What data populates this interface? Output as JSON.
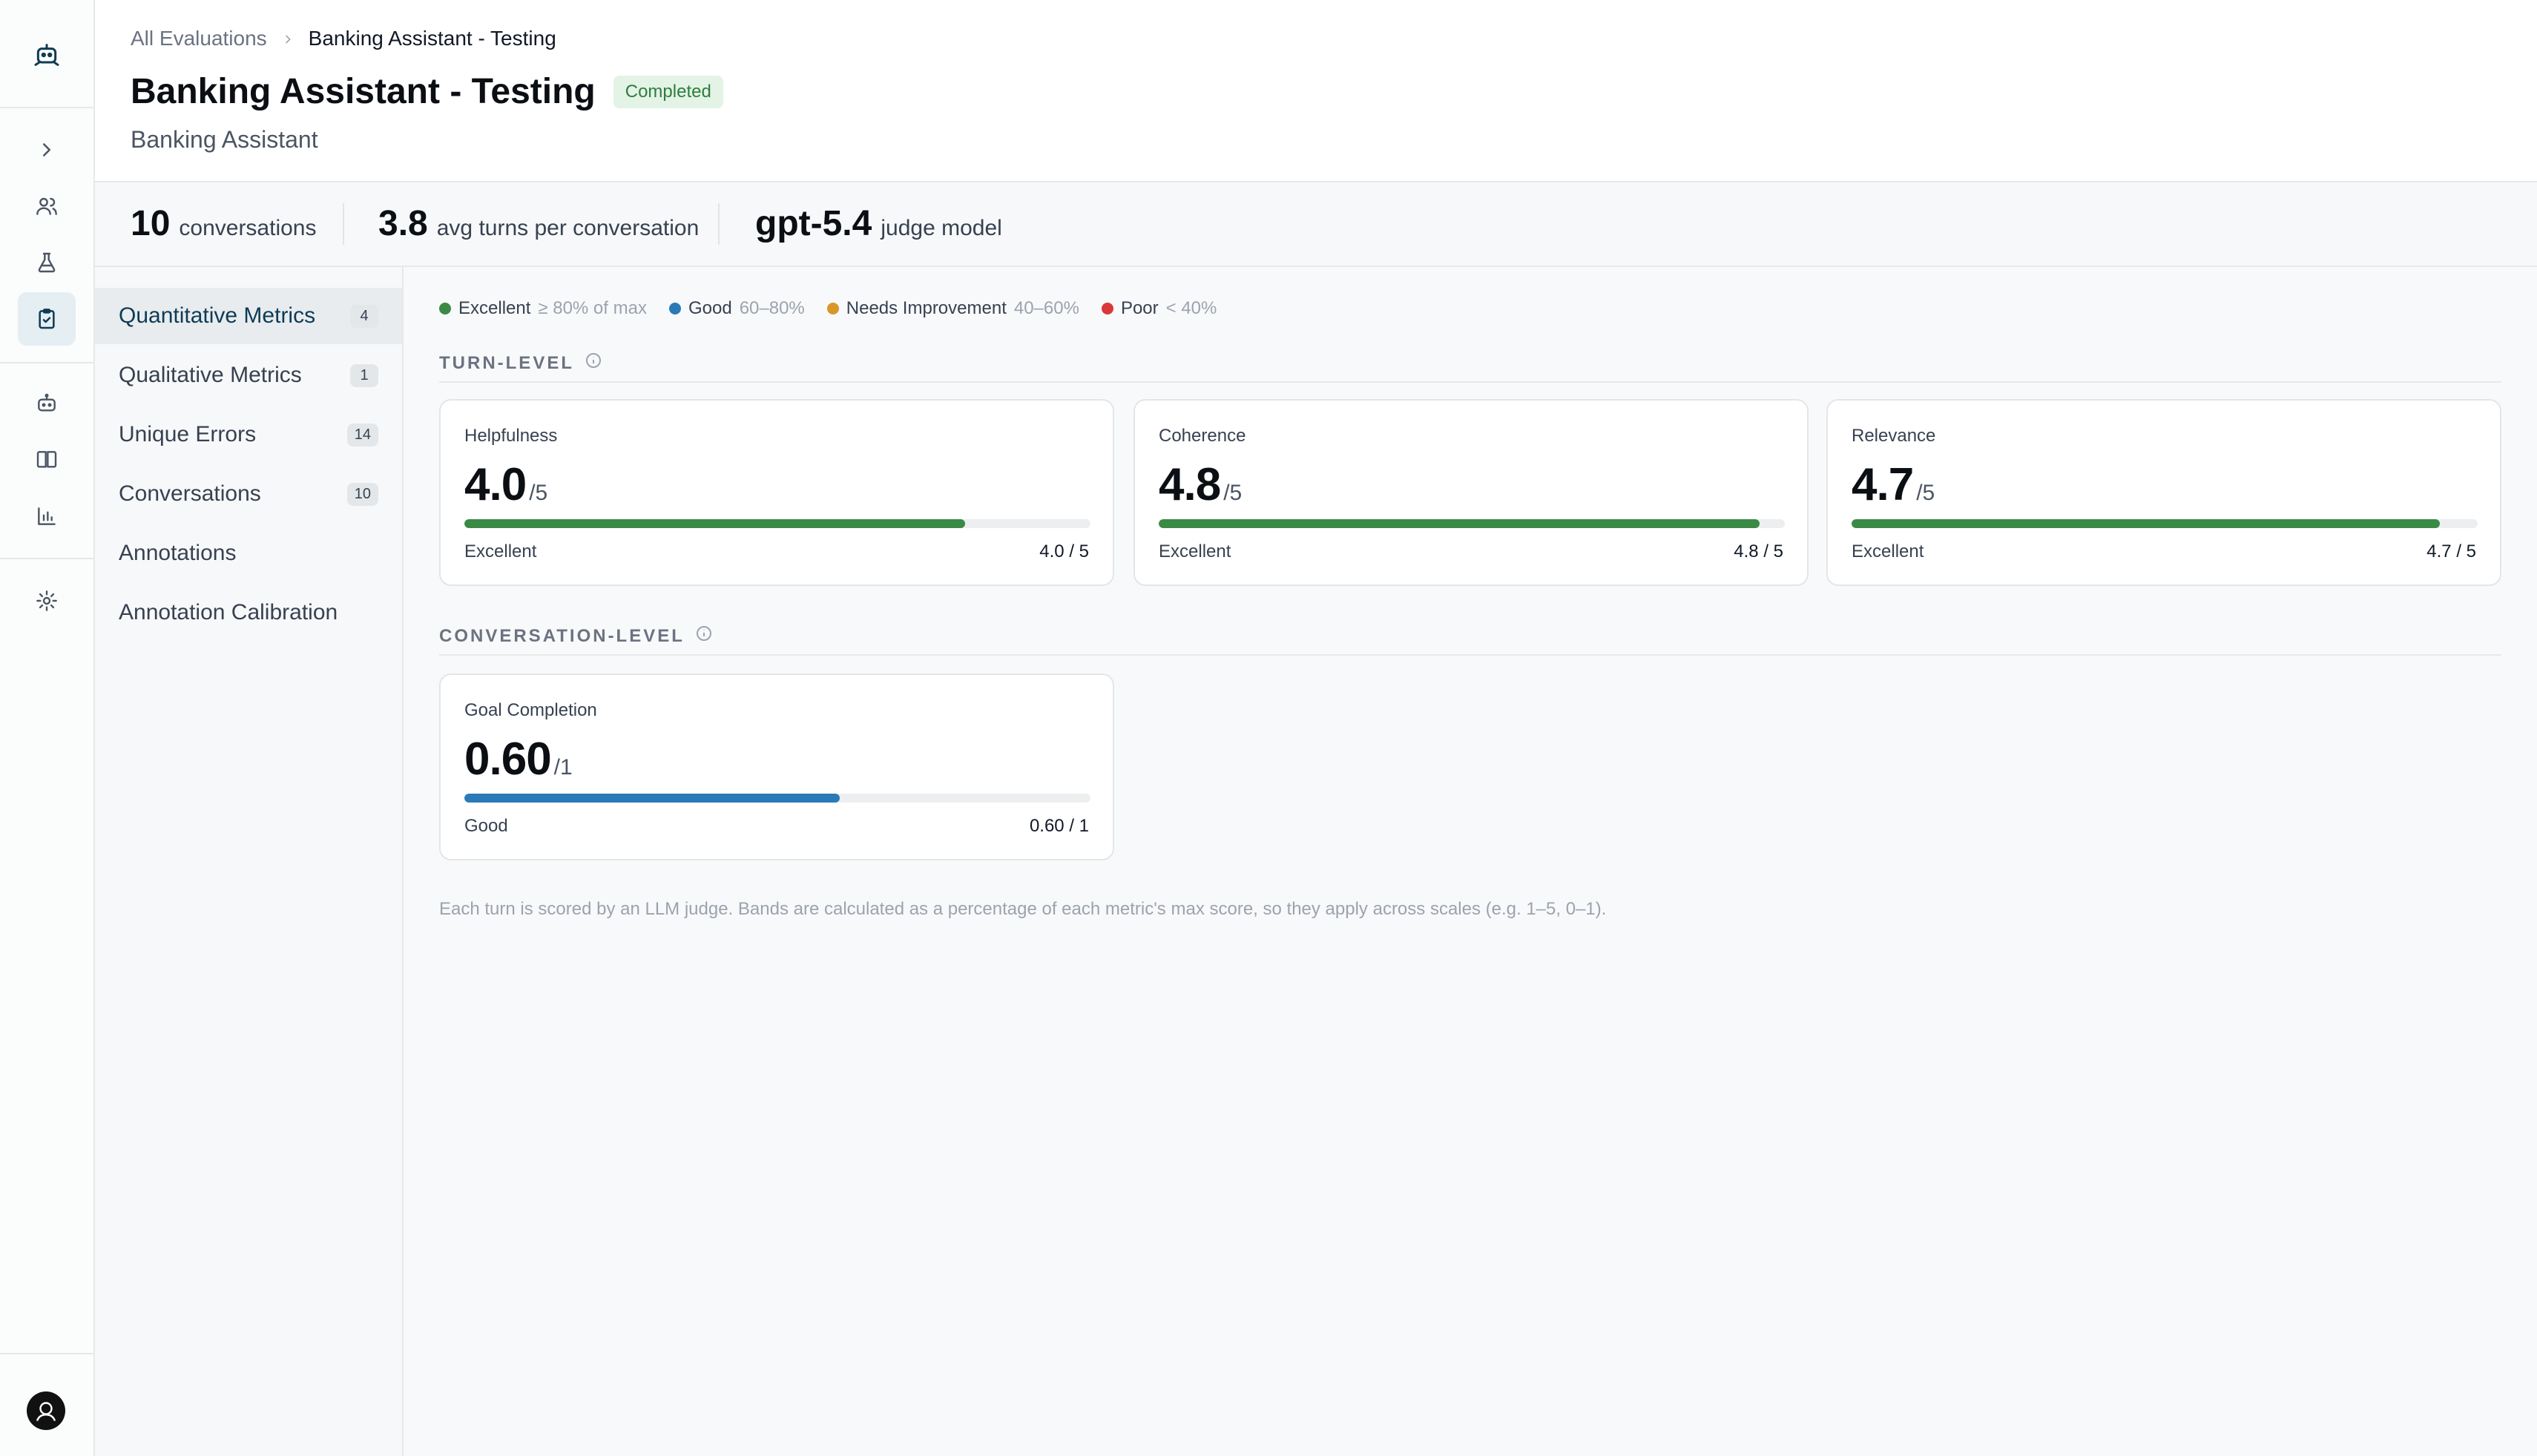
{
  "sidebar_icons": [
    {
      "name": "expand-chevron-icon"
    },
    {
      "name": "users-icon"
    },
    {
      "name": "flask-icon"
    },
    {
      "name": "clipboard-check-icon",
      "active": true
    },
    {
      "name": "bot-icon"
    },
    {
      "name": "book-icon"
    },
    {
      "name": "bar-chart-icon"
    },
    {
      "name": "gear-icon"
    }
  ],
  "breadcrumb": {
    "parent": "All Evaluations",
    "current": "Banking Assistant - Testing"
  },
  "header": {
    "title": "Banking Assistant - Testing",
    "status": "Completed",
    "subtitle": "Banking Assistant"
  },
  "stats": {
    "conversations": {
      "value": "10",
      "label": "conversations"
    },
    "avg_turns": {
      "value": "3.8",
      "label": "avg turns per conversation"
    },
    "judge": {
      "value": "gpt-5.4",
      "label": "judge model"
    }
  },
  "nav": {
    "items": [
      {
        "label": "Quantitative Metrics",
        "count": "4",
        "active": true
      },
      {
        "label": "Qualitative Metrics",
        "count": "1"
      },
      {
        "label": "Unique Errors",
        "count": "14"
      },
      {
        "label": "Conversations",
        "count": "10"
      },
      {
        "label": "Annotations",
        "count": ""
      },
      {
        "label": "Annotation Calibration",
        "count": ""
      }
    ]
  },
  "legend": [
    {
      "name": "Excellent",
      "range": "≥ 80% of max",
      "color": "#3a8a45"
    },
    {
      "name": "Good",
      "range": "60–80%",
      "color": "#2a7ab8"
    },
    {
      "name": "Needs Improvement",
      "range": "40–60%",
      "color": "#d9962b"
    },
    {
      "name": "Poor",
      "range": "< 40%",
      "color": "#d93838"
    }
  ],
  "sections": {
    "turn_level": "TURN-LEVEL",
    "conversation_level": "CONVERSATION-LEVEL"
  },
  "metrics": [
    {
      "name": "Helpfulness",
      "value": "4.0",
      "max": "/5",
      "fraction": 0.8,
      "band": "Excellent",
      "ratio": "4.0 / 5",
      "color": "#3a8a45"
    },
    {
      "name": "Coherence",
      "value": "4.8",
      "max": "/5",
      "fraction": 0.96,
      "band": "Excellent",
      "ratio": "4.8 / 5",
      "color": "#3a8a45"
    },
    {
      "name": "Relevance",
      "value": "4.7",
      "max": "/5",
      "fraction": 0.94,
      "band": "Excellent",
      "ratio": "4.7 / 5",
      "color": "#3a8a45"
    },
    {
      "name": "Goal Completion",
      "value": "0.60",
      "max": "/1",
      "fraction": 0.6,
      "band": "Good",
      "ratio": "0.60 / 1",
      "color": "#2a7ab8"
    }
  ],
  "footnote": "Each turn is scored by an LLM judge. Bands are calculated as a percentage of each metric's max score, so they apply across scales (e.g. 1–5, 0–1)."
}
